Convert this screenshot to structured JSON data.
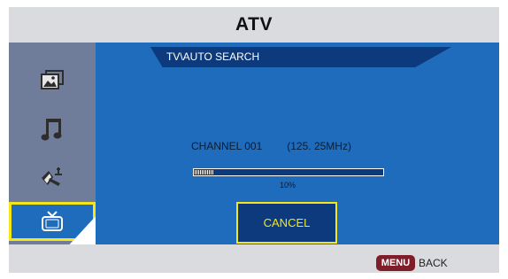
{
  "title": "ATV",
  "header": {
    "path": "TV\\AUTO SEARCH"
  },
  "sidebar": {
    "items": [
      {
        "icon": "picture-icon"
      },
      {
        "icon": "music-icon"
      },
      {
        "icon": "settings-icon"
      },
      {
        "icon": "tv-icon",
        "selected": true
      }
    ]
  },
  "search": {
    "channel_label": "CHANNEL 001",
    "frequency": "(125. 25MHz)",
    "progress_text": "10%",
    "progress": 0.1
  },
  "buttons": {
    "cancel_label": "CANCEL"
  },
  "footer": {
    "menu_key": "MENU",
    "back_label": "BACK"
  },
  "colors": {
    "panel_blue": "#1f6cbd",
    "header_navy": "#0d3a7c",
    "sidebar": "#6f7d9a",
    "highlight": "#f5e61a",
    "menu_key": "#7f1d2a"
  }
}
